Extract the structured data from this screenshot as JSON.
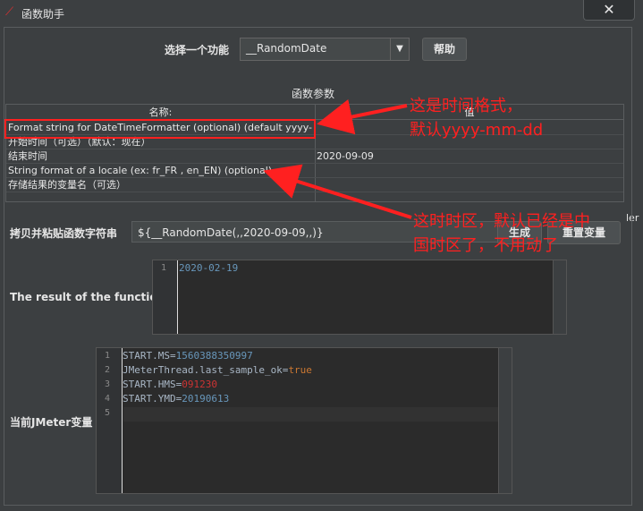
{
  "window": {
    "title": "函数助手",
    "close": "✕"
  },
  "function_select": {
    "label": "选择一个功能",
    "value": "__RandomDate",
    "help_label": "帮助"
  },
  "params": {
    "heading": "函数参数",
    "columns": [
      "名称:",
      "值"
    ],
    "rows": [
      {
        "name": "Format string for DateTimeFormatter (optional) (default yyyy-...",
        "value": ""
      },
      {
        "name": "开始时间（可选）（默认：现在）",
        "value": ""
      },
      {
        "name": "结束时间",
        "value": "2020-09-09"
      },
      {
        "name": "String format of a locale (ex: fr_FR , en_EN) (optional)",
        "value": ""
      },
      {
        "name": "存储结果的变量名（可选）",
        "value": ""
      }
    ]
  },
  "copy": {
    "label": "拷贝并粘贴函数字符串",
    "value": "${__RandomDate(,,2020-09-09,,)}",
    "generate_label": "生成",
    "reset_label": "重置变量"
  },
  "result": {
    "label": "The result of the function is",
    "line_no": "1",
    "value": "2020-02-19"
  },
  "vars": {
    "label": "当前JMeter变量",
    "line_numbers": [
      "1",
      "2",
      "3",
      "4",
      "5"
    ],
    "lines": [
      {
        "key": "START.MS=",
        "val": "1560388350997"
      },
      {
        "key": "JMeterThread.last_sample_ok=",
        "val": "true"
      },
      {
        "key": "START.HMS=",
        "val": "091230"
      },
      {
        "key": "START.YMD=",
        "val": "20190613"
      }
    ]
  },
  "annotations": {
    "note1_line1": "这是时间格式，",
    "note1_line2": "默认yyyy-mm-dd",
    "note2_line1": "这时时区，默认已经是中",
    "note2_line2": "国时区了，不用动了"
  },
  "background_partial_text": "ler",
  "colors": {
    "annotation": "#ff2020",
    "number": "#6897bb",
    "red_value": "#cc3333",
    "keyword": "#cc7832"
  }
}
